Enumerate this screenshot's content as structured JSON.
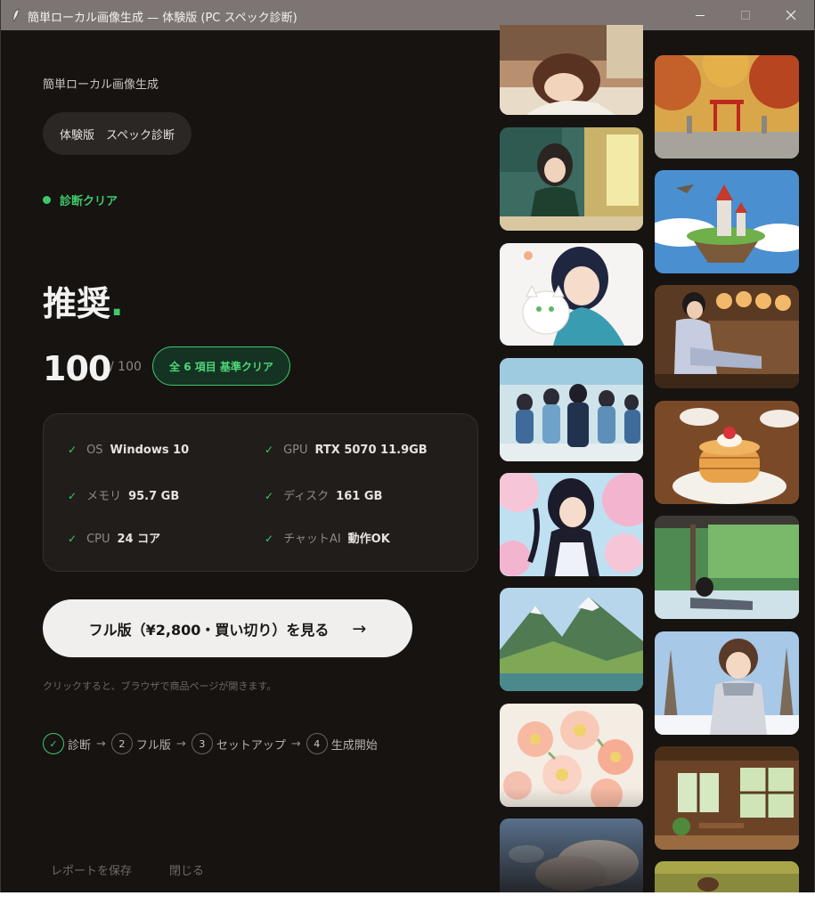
{
  "window": {
    "title": "簡単ローカル画像生成 — 体験版 (PC スペック診断)",
    "controls": {
      "minimize": "—",
      "maximize": "☐",
      "close": "✕"
    }
  },
  "app": {
    "name": "簡単ローカル画像生成",
    "edition": "体験版　スペック診断"
  },
  "status": {
    "label": "診断クリア",
    "color": "#3ec96a"
  },
  "verdict": {
    "text": "推奨",
    "dot": "."
  },
  "score": {
    "value": "100",
    "max": "/ 100",
    "badge": "全 6 項目 基準クリア"
  },
  "specs": [
    {
      "check": "✓",
      "key": "OS",
      "value": "Windows 10"
    },
    {
      "check": "✓",
      "key": "GPU",
      "value": "RTX 5070 11.9GB"
    },
    {
      "check": "✓",
      "key": "メモリ",
      "value": "95.7 GB"
    },
    {
      "check": "✓",
      "key": "ディスク",
      "value": "161 GB"
    },
    {
      "check": "✓",
      "key": "CPU",
      "value": "24 コア"
    },
    {
      "check": "✓",
      "key": "チャットAI",
      "value": "動作OK"
    }
  ],
  "cta": {
    "label": "フル版（¥2,800・買い切り）を見る",
    "arrow": "→",
    "note": "クリックすると、ブラウザで商品ページが開きます。"
  },
  "steps": [
    {
      "marker": "✓",
      "label": "診断",
      "done": true
    },
    {
      "marker": "2",
      "label": "フル版",
      "done": false
    },
    {
      "marker": "3",
      "label": "セットアップ",
      "done": false
    },
    {
      "marker": "4",
      "label": "生成開始",
      "done": false
    }
  ],
  "steps_separator": "→",
  "footer": {
    "save_report": "レポートを保存",
    "close": "閉じる"
  },
  "gallery": {
    "left_column": [
      "girl-sleeping-at-desk",
      "girl-reading-in-library",
      "girl-with-white-cat",
      "students-walking-in-hallway",
      "maid-under-cherry-blossoms",
      "green-mountain-valley",
      "pink-flower-bouquet",
      "clouds-sky"
    ],
    "right_column": [
      "autumn-shrine-garden",
      "floating-island-castle",
      "boy-in-yukata-with-lanterns",
      "pancake-stack",
      "girl-in-hot-spring",
      "girl-in-snow-forest",
      "wooden-cafe-interior",
      "field-partial"
    ]
  },
  "colors": {
    "accent": "#3ec96a",
    "background": "#161311",
    "card": "#201d1b",
    "titlebar": "#7d7573"
  }
}
